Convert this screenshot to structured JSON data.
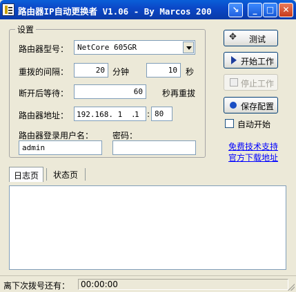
{
  "window": {
    "title": "路由器IP自动更换者 V1.06 - By Marcos 200"
  },
  "settings": {
    "group_title": "设置",
    "router_model_label": "路由器型号：",
    "router_model_value": "NetCore 605GR",
    "redial_interval_label": "重拨的间隔：",
    "redial_minutes": "20",
    "minutes_unit": "分钟",
    "redial_seconds": "10",
    "seconds_unit": "秒",
    "wait_label": "断开后等待：",
    "wait_value": "60",
    "wait_suffix": "秒再重拔",
    "router_address_label": "路由器地址：",
    "ip": [
      "192.168. 1 ",
      " 1 "
    ],
    "ip_dot": ".",
    "port_sep": ":",
    "port": "80",
    "username_label": "路由器登录用户名：",
    "username_value": "admin",
    "password_label": "密码："
  },
  "actions": {
    "test_label": "测试",
    "start_label": "开始工作",
    "stop_label": "停止工作",
    "save_label": "保存配置",
    "autostart_label": "自动开始"
  },
  "links": {
    "support": "免费技术支持",
    "download": "官方下载地址"
  },
  "tabs": [
    {
      "label": "日志页",
      "active": true
    },
    {
      "label": "状态页",
      "active": false
    }
  ],
  "statusbar": {
    "label": "离下次拨号还有：",
    "countdown": "00:00:00"
  },
  "colors": {
    "titlebar": "#0b48c8",
    "window_bg": "#ece9d8",
    "link": "#0000ff",
    "input_border": "#7f9db9"
  },
  "icons": {
    "test": "tool-icon",
    "start": "arrow-right-icon",
    "stop": "stop-icon",
    "save": "save-icon"
  }
}
